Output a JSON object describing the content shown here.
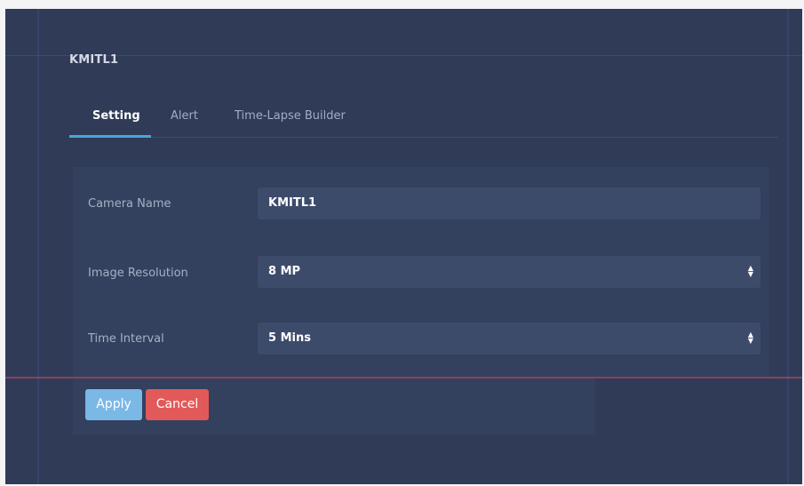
{
  "camera": {
    "title": "KMITL1"
  },
  "tabs": [
    {
      "label": "Setting",
      "active": true
    },
    {
      "label": "Alert",
      "active": false
    },
    {
      "label": "Time-Lapse Builder",
      "active": false
    }
  ],
  "form": {
    "camera_name": {
      "label": "Camera Name",
      "value": "KMITL1"
    },
    "image_resolution": {
      "label": "Image Resolution",
      "value": "8 MP"
    },
    "time_interval": {
      "label": "Time Interval",
      "value": "5 Mins"
    }
  },
  "buttons": {
    "apply": "Apply",
    "cancel": "Cancel"
  },
  "colors": {
    "background": "#2f3b57",
    "tab_accent": "#49a6d8",
    "apply": "#7ab8e6",
    "cancel": "#e2595a"
  },
  "icons": {
    "select_arrows": "select-arrows-icon"
  }
}
